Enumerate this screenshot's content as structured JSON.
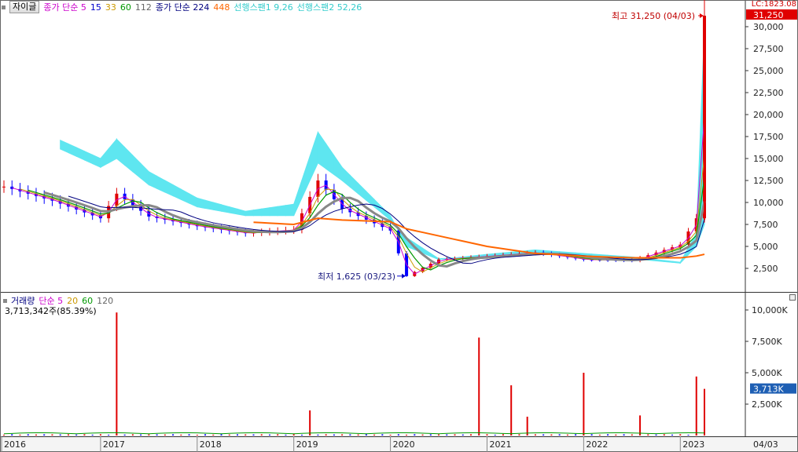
{
  "toolbar": {
    "stock_button": "자이글"
  },
  "price_legend": [
    {
      "text": "종가 단순 5",
      "color": "#cc00cc"
    },
    {
      "text": "15",
      "color": "#0000cc"
    },
    {
      "text": "33",
      "color": "#cc9900"
    },
    {
      "text": "60",
      "color": "#009900"
    },
    {
      "text": "112",
      "color": "#666666"
    },
    {
      "text": "종가 단순 224",
      "color": "#000080"
    },
    {
      "text": "448",
      "color": "#ff6600"
    },
    {
      "text": "선행스팬1 9,26",
      "color": "#33cccc"
    },
    {
      "text": "선행스팬2 52,26",
      "color": "#33cccc"
    }
  ],
  "price_axis": {
    "lc_label": "LC:1823.08",
    "current_price": "31,250",
    "ticks": [
      "30,000",
      "27,500",
      "25,000",
      "22,500",
      "20,000",
      "17,500",
      "15,000",
      "12,500",
      "10,000",
      "7,500",
      "5,000",
      "2,500"
    ]
  },
  "annotations": {
    "high": "최고 31,250 (04/03)",
    "low": "최저 1,625 (03/23)"
  },
  "volume_legend": [
    {
      "text": "거래량",
      "color": "#000080"
    },
    {
      "text": "단순 5",
      "color": "#cc00cc"
    },
    {
      "text": "20",
      "color": "#cc9900"
    },
    {
      "text": "60",
      "color": "#009900"
    },
    {
      "text": "120",
      "color": "#666666"
    }
  ],
  "volume_info": "3,713,342주(85.39%)",
  "volume_axis": {
    "current": "3,713K",
    "ticks": [
      "10,000K",
      "7,500K",
      "5,000K",
      "2,500K"
    ]
  },
  "x_axis": {
    "labels": [
      "2016",
      "2017",
      "2018",
      "2019",
      "2020",
      "2021",
      "2022",
      "2023"
    ],
    "right_label": "04/03"
  },
  "colors": {
    "candle_up": "#e00000",
    "candle_down": "#0000ff",
    "cloud": "#5ee6f0",
    "ma5": "#cc00cc",
    "ma15": "#0000cc",
    "ma33": "#cc9900",
    "ma60": "#009900",
    "ma112": "#888888",
    "ma224": "#000080",
    "ma448": "#ff6600"
  },
  "chart_data": {
    "type": "line",
    "title": "자이글",
    "price_ylim": [
      0,
      31250
    ],
    "x": [
      "2016-01",
      "2016-07",
      "2017-01",
      "2017-03",
      "2017-07",
      "2018-01",
      "2018-07",
      "2019-01",
      "2019-04",
      "2019-07",
      "2020-01",
      "2020-03",
      "2020-07",
      "2021-01",
      "2021-07",
      "2022-01",
      "2022-07",
      "2023-01",
      "2023-03",
      "2023-04"
    ],
    "series": [
      {
        "name": "종가",
        "values": [
          11800,
          10200,
          8200,
          11000,
          8400,
          7300,
          6500,
          6900,
          12500,
          9300,
          6800,
          1625,
          3500,
          3900,
          4300,
          3500,
          3400,
          5200,
          8200,
          31250
        ]
      },
      {
        "name": "선행스팬1 9,26",
        "values": [
          null,
          17500,
          15000,
          17200,
          13500,
          10500,
          9000,
          9800,
          18000,
          14000,
          8500,
          5000,
          3500,
          4100,
          4600,
          4200,
          3800,
          3200,
          6500,
          30000
        ]
      },
      {
        "name": "선행스팬2 52,26",
        "values": [
          null,
          16500,
          14000,
          15000,
          12000,
          9500,
          8500,
          8500,
          14500,
          12500,
          8000,
          6000,
          3600,
          3900,
          4300,
          4000,
          3600,
          3100,
          5000,
          7500
        ]
      },
      {
        "name": "448",
        "values": [
          null,
          null,
          null,
          null,
          null,
          null,
          7800,
          7500,
          8200,
          8000,
          7800,
          7000,
          6200,
          5000,
          4200,
          3900,
          3700,
          3700,
          3900,
          4100
        ]
      }
    ],
    "volume_ylim": [
      0,
      11250
    ],
    "volume_unit": "K",
    "volume_spikes": [
      {
        "x": "2017-03",
        "value": 9800
      },
      {
        "x": "2019-03",
        "value": 2000
      },
      {
        "x": "2020-12",
        "value": 7800
      },
      {
        "x": "2021-04",
        "value": 4000
      },
      {
        "x": "2021-06",
        "value": 1500
      },
      {
        "x": "2022-01",
        "value": 5000
      },
      {
        "x": "2022-08",
        "value": 1600
      },
      {
        "x": "2023-03",
        "value": 4700
      },
      {
        "x": "2023-04",
        "value": 3713
      }
    ]
  }
}
